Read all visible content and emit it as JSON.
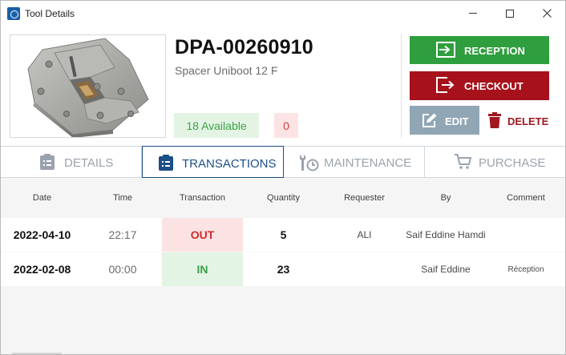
{
  "window": {
    "title": "Tool Details"
  },
  "tool": {
    "code": "DPA-00260910",
    "description": "Spacer Uniboot 12 F",
    "available": "18 Available",
    "unavailable": "0"
  },
  "actions": {
    "reception": "RECEPTION",
    "checkout": "CHECKOUT",
    "edit": "EDIT",
    "delete": "DELETE"
  },
  "tabs": [
    {
      "label": "DETAILS",
      "icon": "clipboard-list-icon"
    },
    {
      "label": "TRANSACTIONS",
      "icon": "clipboard-list-icon",
      "active": true
    },
    {
      "label": "MAINTENANCE",
      "icon": "tools-clock-icon"
    },
    {
      "label": "PURCHASE",
      "icon": "cart-icon"
    }
  ],
  "table": {
    "columns": [
      "Date",
      "Time",
      "Transaction",
      "Quantity",
      "Requester",
      "By",
      "Comment"
    ],
    "rows": [
      {
        "date": "2022-04-10",
        "time": "22:17",
        "transaction": "OUT",
        "quantity": "5",
        "requester": "ALI",
        "by": "Saif Eddine Hamdi",
        "comment": ""
      },
      {
        "date": "2022-02-08",
        "time": "00:00",
        "transaction": "IN",
        "quantity": "23",
        "requester": "",
        "by": "Saif Eddine",
        "comment": "Réception"
      }
    ]
  },
  "colors": {
    "reception": "#2f9e3e",
    "checkout": "#a7111b",
    "edit": "#91a6b5",
    "delete": "#a01720",
    "active_tab": "#1b4f86",
    "available_bg": "#e4f4e4",
    "unavailable_bg": "#fde4e4"
  }
}
